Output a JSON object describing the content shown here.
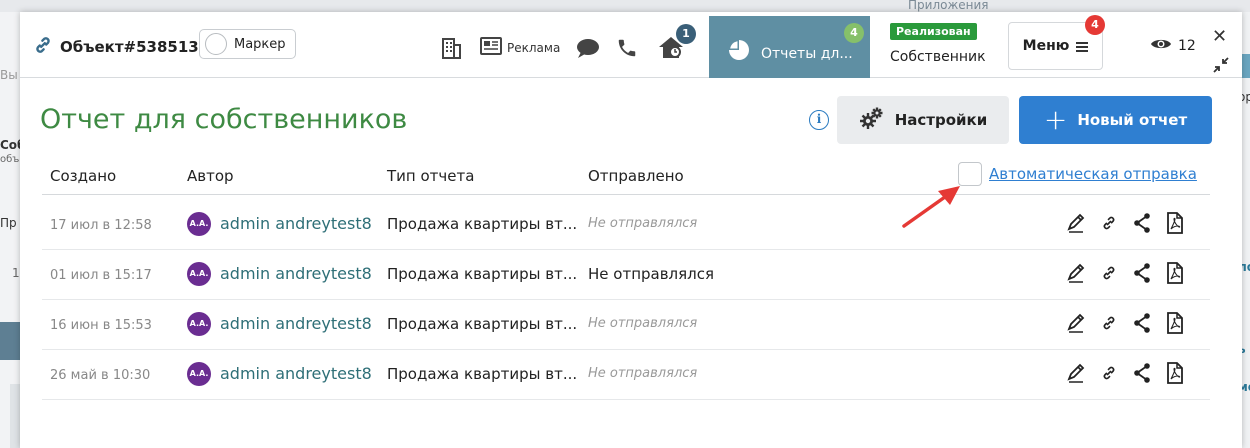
{
  "background": {
    "left_fragments": [
      "Вы",
      "Соб",
      "объе",
      "Пр",
      "1"
    ],
    "right_fragments": [
      "ор",
      "ло",
      "ь",
      "ме"
    ],
    "top_strip": "Приложения"
  },
  "topbar": {
    "object_title": "Объект#538513",
    "marker_label": "Маркер",
    "ads_label": "Реклама",
    "house_badge": "1",
    "reports_tab_label": "Отчеты дл...",
    "reports_tab_badge": "4",
    "status_badge": "Реализован",
    "owner_label": "Собственник",
    "menu_label": "Меню",
    "menu_badge": "4",
    "views_count": "12"
  },
  "content": {
    "title": "Отчет для собственников",
    "info_icon": "i",
    "settings_label": "Настройки",
    "new_report_label": "Новый отчет",
    "auto_send_label": "Автоматическая отправка",
    "columns": [
      "Создано",
      "Автор",
      "Тип отчета",
      "Отправлено"
    ],
    "rows": [
      {
        "created": "17 июл в 12:58",
        "initials": "A.A.",
        "author": "admin andreytest8",
        "type": "Продажа квартиры вт...",
        "sent": "Не отправлялся",
        "sent_style": "italic"
      },
      {
        "created": "01 июл в 15:17",
        "initials": "A.A.",
        "author": "admin andreytest8",
        "type": "Продажа квартиры вт...",
        "sent": "Не отправлялся",
        "sent_style": "plain"
      },
      {
        "created": "16 июн в 15:53",
        "initials": "A.A.",
        "author": "admin andreytest8",
        "type": "Продажа квартиры вт...",
        "sent": "Не отправлялся",
        "sent_style": "italic"
      },
      {
        "created": "26 май в 10:30",
        "initials": "A.A.",
        "author": "admin andreytest8",
        "type": "Продажа квартиры вт...",
        "sent": "Не отправлялся",
        "sent_style": "italic"
      }
    ]
  },
  "colors": {
    "title_green": "#3e8a43",
    "tab_active": "#5f8fa3",
    "primary_blue": "#2f7fd1",
    "status_green": "#2a9a3b",
    "badge_blue": "#3a5f78",
    "badge_red": "#e53935",
    "badge_green": "#86c06a",
    "avatar_purple": "#6a2d91",
    "arrow_red": "#e53935"
  },
  "icons": [
    "link-icon",
    "building-icon",
    "newspaper-icon",
    "chat-icon",
    "phone-icon",
    "house-icon",
    "pie-chart-icon",
    "hamburger-icon",
    "eye-icon",
    "close-icon",
    "collapse-icon",
    "info-icon",
    "gears-icon",
    "plus-icon",
    "pen-icon",
    "link-icon",
    "share-icon",
    "pdf-icon"
  ]
}
